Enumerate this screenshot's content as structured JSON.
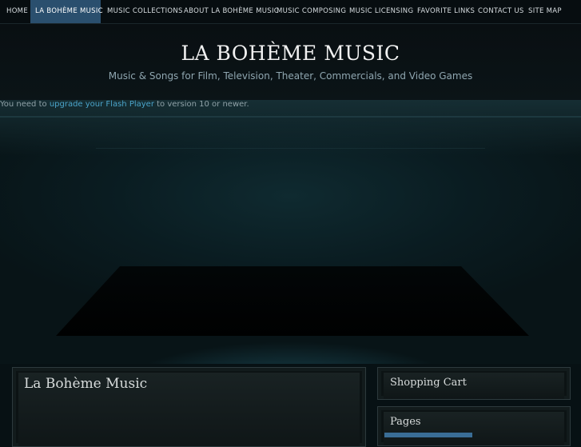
{
  "nav": {
    "items": [
      {
        "label": "HOME"
      },
      {
        "label": "LA BOHÈME MUSIC"
      },
      {
        "label": "MUSIC COLLECTIONS"
      },
      {
        "label": "ABOUT LA BOHÈME MUSIC"
      },
      {
        "label": "MUSIC COMPOSING"
      },
      {
        "label": "MUSIC LICENSING"
      },
      {
        "label": "FAVORITE LINKS"
      },
      {
        "label": "CONTACT US"
      },
      {
        "label": "SITE MAP"
      }
    ],
    "active_index": 1
  },
  "header": {
    "title": "LA BOHÈME MUSIC",
    "subtitle": "Music & Songs for Film, Television, Theater, Commercials, and Video Games"
  },
  "flash": {
    "prefix": "You need to ",
    "link": "upgrade your Flash Player",
    "suffix": " to version 10 or newer."
  },
  "main": {
    "title": "La Bohème Music"
  },
  "sidebar": {
    "cart_title": "Shopping Cart",
    "pages_title": "Pages"
  },
  "colors": {
    "accent": "#2a4f6e",
    "link": "#4aa3c9"
  }
}
